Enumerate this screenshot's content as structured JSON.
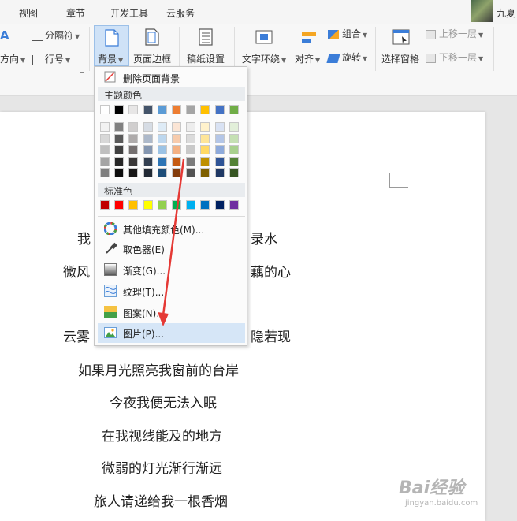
{
  "tabs": [
    "视图",
    "章节",
    "开发工具",
    "云服务"
  ],
  "user": {
    "name": "九夏"
  },
  "ribbon": {
    "direction": "方向",
    "separator": "分隔符",
    "line_number": "行号",
    "background": "背景",
    "page_border": "页面边框",
    "manuscript_setup": "稿纸设置",
    "text_wrap": "文字环绕",
    "align": "对齐",
    "group": "组合",
    "rotate": "旋转",
    "selection_pane": "选择窗格",
    "bring_forward": "上移一层",
    "send_backward": "下移一层"
  },
  "menu": {
    "remove_background": "删除页面背景",
    "theme_colors_header": "主题颜色",
    "standard_colors_header": "标准色",
    "more_fill_colors": "其他填充颜色(M)...",
    "eyedropper": "取色器(E)",
    "gradient": "渐变(G)...",
    "texture": "纹理(T)...",
    "pattern": "图案(N)...",
    "picture": "图片(P)..."
  },
  "theme_colors": {
    "base": [
      "#ffffff",
      "#000000",
      "#e7e6e6",
      "#44546a",
      "#5b9bd5",
      "#ed7d31",
      "#a5a5a5",
      "#ffc000",
      "#4472c4",
      "#70ad47"
    ],
    "shades": [
      [
        "#f2f2f2",
        "#808080",
        "#d0cece",
        "#d6dce4",
        "#deebf6",
        "#fbe5d5",
        "#ededed",
        "#fff2cc",
        "#d9e2f3",
        "#e2efd9"
      ],
      [
        "#d8d8d8",
        "#595959",
        "#aeabab",
        "#adb9ca",
        "#bdd7ee",
        "#f7cbac",
        "#dbdbdb",
        "#fee599",
        "#b4c6e7",
        "#c5e0b3"
      ],
      [
        "#bfbfbf",
        "#404040",
        "#757070",
        "#8496b0",
        "#9cc3e5",
        "#f4b183",
        "#c9c9c9",
        "#ffd966",
        "#8eaadb",
        "#a8d08d"
      ],
      [
        "#a5a5a5",
        "#262626",
        "#3a3838",
        "#333f50",
        "#2e75b5",
        "#c55a11",
        "#7b7b7b",
        "#bf9000",
        "#2f5496",
        "#538135"
      ],
      [
        "#7f7f7f",
        "#0d0d0d",
        "#171616",
        "#222a35",
        "#1e4e79",
        "#843c0b",
        "#525252",
        "#7f6000",
        "#1f3864",
        "#375623"
      ]
    ]
  },
  "standard_colors": [
    "#c00000",
    "#ff0000",
    "#ffc000",
    "#ffff00",
    "#92d050",
    "#00b050",
    "#00b0f0",
    "#0070c0",
    "#002060",
    "#7030a0"
  ],
  "poem": {
    "line1": "我",
    "line1_right": "录水",
    "line2": "微风",
    "line2_right": "藕的心",
    "line3": "云雾",
    "line3_right": "隐若现",
    "line4": "如果月光照亮我窗前的台岸",
    "line5": "今夜我便无法入眠",
    "line6": "在我视线能及的地方",
    "line7": "微弱的灯光渐行渐远",
    "line8": "旅人请递给我一根香烟"
  },
  "watermark": {
    "brand": "Bai经验",
    "url": "jingyan.baidu.com"
  },
  "accent": "#e53935"
}
